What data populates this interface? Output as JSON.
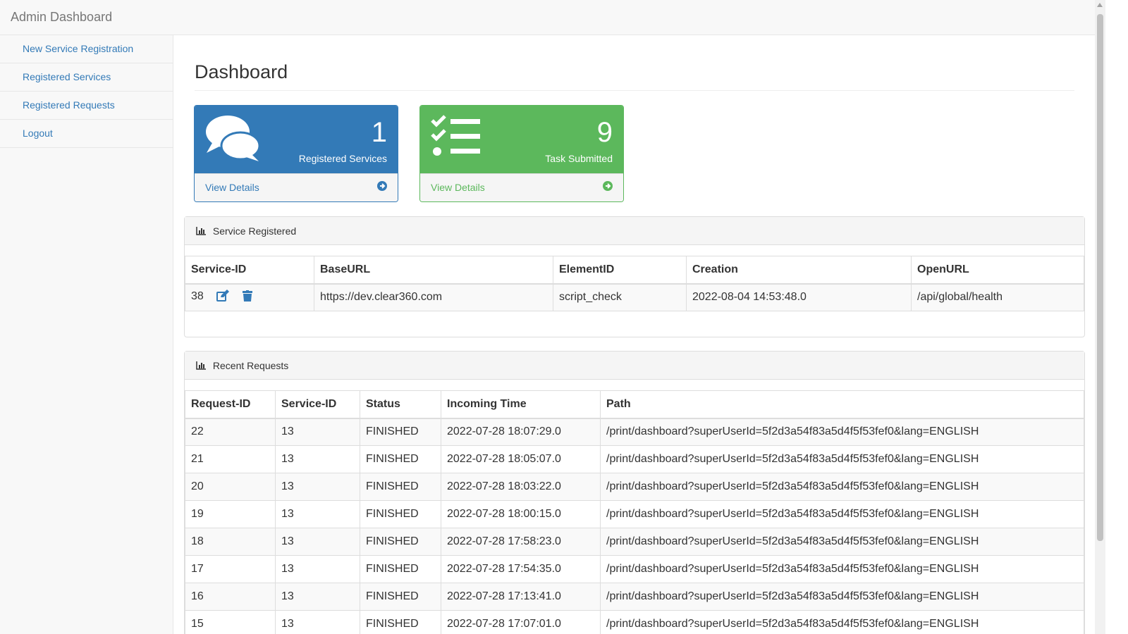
{
  "app": {
    "title": "Admin Dashboard"
  },
  "sidebar": {
    "items": [
      {
        "label": "New Service Registration"
      },
      {
        "label": "Registered Services"
      },
      {
        "label": "Registered Requests"
      },
      {
        "label": "Logout"
      }
    ]
  },
  "page": {
    "title": "Dashboard"
  },
  "cards": {
    "services": {
      "count": "1",
      "label": "Registered Services",
      "link": "View Details",
      "color": "#337ab7",
      "icon": "comments-icon"
    },
    "tasks": {
      "count": "9",
      "label": "Task Submitted",
      "link": "View Details",
      "color": "#5cb85c",
      "icon": "tasks-icon"
    }
  },
  "services_panel": {
    "title": "Service Registered",
    "columns": [
      "Service-ID",
      "BaseURL",
      "ElementID",
      "Creation",
      "OpenURL"
    ],
    "rows": [
      {
        "id": "38",
        "base_url": "https://dev.clear360.com",
        "element_id": "script_check",
        "creation": "2022-08-04 14:53:48.0",
        "open_url": "/api/global/health"
      }
    ]
  },
  "requests_panel": {
    "title": "Recent Requests",
    "columns": [
      "Request-ID",
      "Service-ID",
      "Status",
      "Incoming Time",
      "Path"
    ],
    "rows": [
      {
        "request_id": "22",
        "service_id": "13",
        "status": "FINISHED",
        "time": "2022-07-28 18:07:29.0",
        "path": "/print/dashboard?superUserId=5f2d3a54f83a5d4f5f53fef0&lang=ENGLISH"
      },
      {
        "request_id": "21",
        "service_id": "13",
        "status": "FINISHED",
        "time": "2022-07-28 18:05:07.0",
        "path": "/print/dashboard?superUserId=5f2d3a54f83a5d4f5f53fef0&lang=ENGLISH"
      },
      {
        "request_id": "20",
        "service_id": "13",
        "status": "FINISHED",
        "time": "2022-07-28 18:03:22.0",
        "path": "/print/dashboard?superUserId=5f2d3a54f83a5d4f5f53fef0&lang=ENGLISH"
      },
      {
        "request_id": "19",
        "service_id": "13",
        "status": "FINISHED",
        "time": "2022-07-28 18:00:15.0",
        "path": "/print/dashboard?superUserId=5f2d3a54f83a5d4f5f53fef0&lang=ENGLISH"
      },
      {
        "request_id": "18",
        "service_id": "13",
        "status": "FINISHED",
        "time": "2022-07-28 17:58:23.0",
        "path": "/print/dashboard?superUserId=5f2d3a54f83a5d4f5f53fef0&lang=ENGLISH"
      },
      {
        "request_id": "17",
        "service_id": "13",
        "status": "FINISHED",
        "time": "2022-07-28 17:54:35.0",
        "path": "/print/dashboard?superUserId=5f2d3a54f83a5d4f5f53fef0&lang=ENGLISH"
      },
      {
        "request_id": "16",
        "service_id": "13",
        "status": "FINISHED",
        "time": "2022-07-28 17:13:41.0",
        "path": "/print/dashboard?superUserId=5f2d3a54f83a5d4f5f53fef0&lang=ENGLISH"
      },
      {
        "request_id": "15",
        "service_id": "13",
        "status": "FINISHED",
        "time": "2022-07-28 17:07:01.0",
        "path": "/print/dashboard?superUserId=5f2d3a54f83a5d4f5f53fef0&lang=ENGLISH"
      }
    ]
  }
}
